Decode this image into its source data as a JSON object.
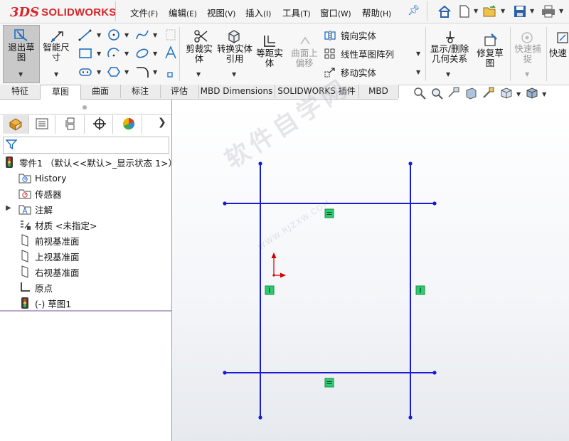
{
  "brand": {
    "logo_mark": "3DS",
    "logo_text": "SOLIDWORKS",
    "brand_color": "#d7262a"
  },
  "menu": {
    "items": [
      {
        "label": "文件",
        "key": "(F)"
      },
      {
        "label": "编辑",
        "key": "(E)"
      },
      {
        "label": "视图",
        "key": "(V)"
      },
      {
        "label": "插入",
        "key": "(I)"
      },
      {
        "label": "工具",
        "key": "(T)"
      },
      {
        "label": "窗口",
        "key": "(W)"
      },
      {
        "label": "帮助",
        "key": "(H)"
      }
    ],
    "quick_access_icons": [
      "home-icon",
      "new-document-icon",
      "open-icon",
      "save-icon",
      "print-icon"
    ]
  },
  "ribbon": {
    "exit_sketch": "退出草图",
    "smart_dimension": "智能尺寸",
    "trim_entities": "剪裁实体",
    "convert_entities": "转换实体引用",
    "offset_entities": "等距实体",
    "offset_on_surface": "曲面上偏移",
    "mirror_entities": "镜向实体",
    "linear_pattern": "线性草图阵列",
    "move_entities": "移动实体",
    "display_relations": "显示/删除几何关系",
    "repair_sketch": "修复草图",
    "rapid_snaps": "快速捕捉",
    "rapid_sketch": "快速"
  },
  "tabs": [
    {
      "label": "特征",
      "active": false
    },
    {
      "label": "草图",
      "active": true
    },
    {
      "label": "曲面",
      "active": false
    },
    {
      "label": "标注",
      "active": false
    },
    {
      "label": "评估",
      "active": false
    },
    {
      "label": "MBD Dimensions",
      "active": false
    },
    {
      "label": "SOLIDWORKS 插件",
      "active": false
    },
    {
      "label": "MBD",
      "active": false
    }
  ],
  "feature_tree": {
    "root": "零件1 （默认<<默认>_显示状态 1>）",
    "items": [
      {
        "label": "History",
        "icon": "history-folder-icon"
      },
      {
        "label": "传感器",
        "icon": "sensor-icon"
      },
      {
        "label": "注解",
        "icon": "annotation-icon",
        "expandable": true
      },
      {
        "label": "材质 <未指定>",
        "icon": "material-icon"
      },
      {
        "label": "前视基准面",
        "icon": "plane-icon"
      },
      {
        "label": "上视基准面",
        "icon": "plane-icon"
      },
      {
        "label": "右视基准面",
        "icon": "plane-icon"
      },
      {
        "label": "原点",
        "icon": "origin-icon"
      },
      {
        "label": "(-) 草图1",
        "icon": "sketch-icon"
      }
    ]
  },
  "watermark": {
    "text": "软件自学网",
    "url": "WWW.RJZXW.COM"
  },
  "colors": {
    "sketch_line": "#1a1ad6",
    "relation_marker": "#2ecc71",
    "origin": "#d10000"
  }
}
